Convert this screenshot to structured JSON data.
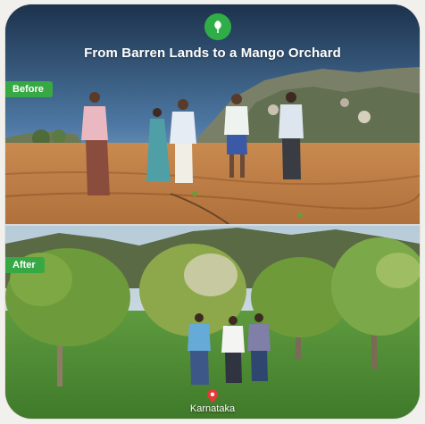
{
  "header": {
    "logo_icon": "mango-leaf-logo-icon",
    "title": "From Barren Lands to a Mango Orchard"
  },
  "before_panel": {
    "tag": "Before"
  },
  "after_panel": {
    "tag": "After",
    "location_icon": "map-pin-icon",
    "location": "Karnataka"
  },
  "colors": {
    "brand_green": "#37a944",
    "location_pin": "#e53935"
  }
}
